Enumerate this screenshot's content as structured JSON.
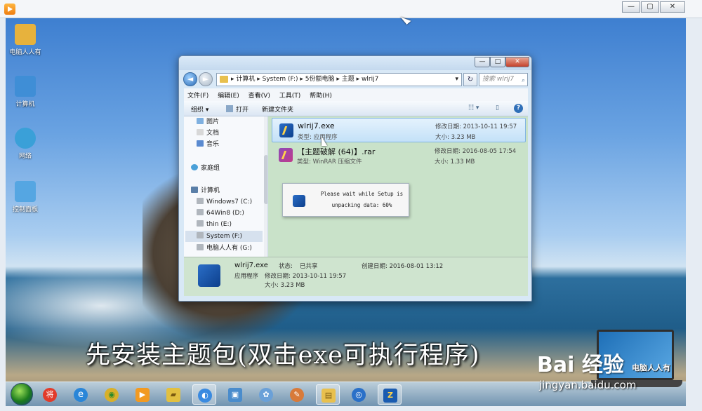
{
  "player": {
    "controls": [
      "—",
      "▢",
      "✕"
    ]
  },
  "desktop_icons": [
    {
      "label": "电脑人人有",
      "icon": "folder-user-icon",
      "color": "#e7b23d"
    },
    {
      "label": "计算机",
      "icon": "computer-icon",
      "color": "#3f8ed6"
    },
    {
      "label": "网络",
      "icon": "network-globe-icon",
      "color": "#3aa0d8"
    },
    {
      "label": "控制面板",
      "icon": "control-panel-icon",
      "color": "#55a6e2"
    }
  ],
  "explorer": {
    "window_controls": [
      "—",
      "□",
      "✕"
    ],
    "back": "◄",
    "forward": "►",
    "address": "▸ 计算机 ▸ System (F:) ▸ 5份额电脑 ▸ 主题 ▸ wlrij7",
    "address_dropdown": "▾",
    "refresh": "↻",
    "search_placeholder": "搜索 wlrij7",
    "search_glyph": "⌕",
    "menu": [
      "文件(F)",
      "编辑(E)",
      "查看(V)",
      "工具(T)",
      "帮助(H)"
    ],
    "toolbar": {
      "organize": "组织 ▾",
      "open": "打开",
      "new_folder": "新建文件夹",
      "view_glyph": "☷ ▾",
      "pane_glyph": "▯",
      "help_glyph": "?"
    },
    "nav_items": [
      {
        "label": "图片",
        "color": "#7fb0e0",
        "indent": 1
      },
      {
        "label": "文档",
        "color": "#d8d8d8",
        "indent": 1
      },
      {
        "label": "音乐",
        "color": "#5a8ad0",
        "indent": 1
      },
      {
        "label": "家庭组",
        "color": "#4aa0d8",
        "indent": 0
      },
      {
        "label": "计算机",
        "color": "#5a7fa8",
        "indent": 0
      },
      {
        "label": "Windows7 (C:)",
        "color": "#b0b6bd",
        "indent": 1
      },
      {
        "label": "64Win8  (D:)",
        "color": "#b0b6bd",
        "indent": 1
      },
      {
        "label": "thin (E:)",
        "color": "#b0b6bd",
        "indent": 1
      },
      {
        "label": "System (F:)",
        "color": "#b0b6bd",
        "indent": 1,
        "selected": true
      },
      {
        "label": "电脑人人有 (G:)",
        "color": "#b0b6bd",
        "indent": 1
      }
    ],
    "files": [
      {
        "name": "wlrij7.exe",
        "type": "类型: 应用程序",
        "date": "修改日期: 2013-10-11 19:57",
        "size": "大小: 3.23 MB",
        "selected": true
      },
      {
        "name": "【主题破解 (64)】.rar",
        "type": "类型: WinRAR 压缩文件",
        "date": "修改日期: 2016-08-05 17:54",
        "size": "大小: 1.33 MB",
        "selected": false
      }
    ],
    "setup_dialog": {
      "line1": "Please wait while Setup is",
      "line2": "unpacking data: 60%"
    },
    "details": {
      "name": "wlrij7.exe",
      "type": "应用程序",
      "modified": "修改日期: 2013-10-11 19:57",
      "size": "大小: 3.23 MB",
      "status_label": "状态:",
      "status_value": "已共享",
      "created": "创建日期: 2016-08-01 13:12"
    }
  },
  "caption": "先安装主题包(双击exe可执行程序)",
  "taskbar": {
    "buttons": [
      {
        "name": "taskbar-app-jiang",
        "glyph": "将",
        "color": "#e23b2a"
      },
      {
        "name": "taskbar-ie",
        "glyph": "e",
        "color": "#2a86d8"
      },
      {
        "name": "taskbar-chrome",
        "glyph": "◉",
        "color": "#d8b02a"
      },
      {
        "name": "taskbar-media-player",
        "glyph": "▶",
        "color": "#f29a22"
      },
      {
        "name": "taskbar-folder-app",
        "glyph": "▰",
        "color": "#e2c040"
      },
      {
        "name": "taskbar-browser",
        "glyph": "◐",
        "color": "#3a8ae0",
        "active": true
      },
      {
        "name": "taskbar-remote",
        "glyph": "▣",
        "color": "#4a8ccc"
      },
      {
        "name": "taskbar-flower",
        "glyph": "✿",
        "color": "#6aa0d8"
      },
      {
        "name": "taskbar-paint",
        "glyph": "✎",
        "color": "#d87a3a"
      },
      {
        "name": "taskbar-explorer",
        "glyph": "▤",
        "color": "#e8c04e",
        "active": true
      },
      {
        "name": "taskbar-app-blue",
        "glyph": "◎",
        "color": "#2a70c8"
      },
      {
        "name": "taskbar-setup",
        "glyph": "Z",
        "color": "#1a5bb0",
        "active": true
      }
    ]
  },
  "watermark": {
    "brand": "Bai 经验",
    "laptop_text": "电脑人人有",
    "url": "jingyan.baidu.com"
  }
}
